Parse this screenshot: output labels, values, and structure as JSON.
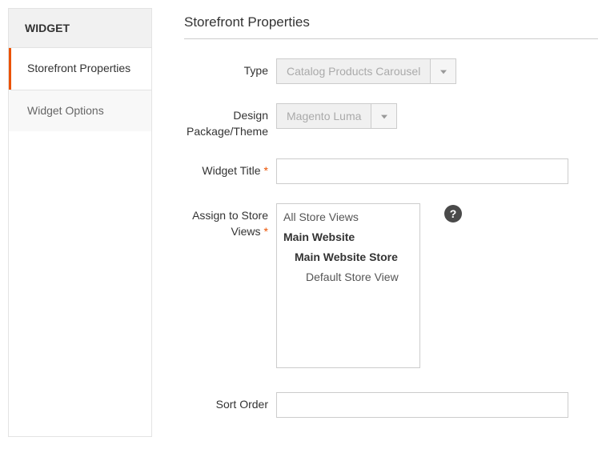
{
  "sidebar": {
    "header": "WIDGET",
    "tabs": [
      {
        "label": "Storefront Properties",
        "active": true
      },
      {
        "label": "Widget Options",
        "active": false
      }
    ]
  },
  "section": {
    "title": "Storefront Properties"
  },
  "fields": {
    "type": {
      "label": "Type",
      "value": "Catalog Products Carousel"
    },
    "theme": {
      "label": "Design Package/Theme",
      "value": "Magento Luma"
    },
    "widget_title": {
      "label": "Widget Title",
      "value": ""
    },
    "store_views": {
      "label": "Assign to Store Views",
      "options": [
        {
          "text": "All Store Views",
          "bold": false,
          "indent": 0
        },
        {
          "text": "Main Website",
          "bold": true,
          "indent": 0
        },
        {
          "text": "Main Website Store",
          "bold": true,
          "indent": 1
        },
        {
          "text": "Default Store View",
          "bold": false,
          "indent": 2
        }
      ]
    },
    "sort_order": {
      "label": "Sort Order",
      "value": ""
    }
  },
  "help_glyph": "?"
}
